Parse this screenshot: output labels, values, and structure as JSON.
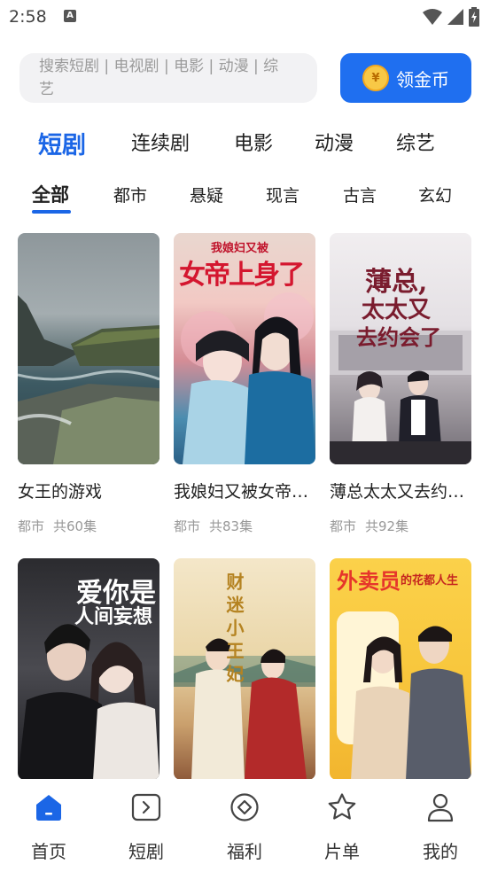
{
  "status": {
    "time": "2:58",
    "notification": "A"
  },
  "search": {
    "placeholder_line1": "搜索短剧 | 电视剧 | 电影 | 动漫 | 综",
    "placeholder_line2": "艺"
  },
  "coin_button": {
    "icon": "¥",
    "label": "领金币"
  },
  "category_tabs": [
    {
      "label": "短剧",
      "active": true
    },
    {
      "label": "连续剧"
    },
    {
      "label": "电影"
    },
    {
      "label": "动漫"
    },
    {
      "label": "综艺"
    }
  ],
  "genre_tabs": [
    {
      "label": "全部",
      "active": true
    },
    {
      "label": "都市"
    },
    {
      "label": "悬疑"
    },
    {
      "label": "现言"
    },
    {
      "label": "古言"
    },
    {
      "label": "玄幻"
    }
  ],
  "dramas": [
    {
      "title": "女王的游戏",
      "genre": "都市",
      "episodes": "共60集"
    },
    {
      "title": "我娘妇又被女帝…",
      "genre": "都市",
      "episodes": "共83集",
      "poster_top": "我娘妇又被",
      "poster_main": "女帝上身了"
    },
    {
      "title": "薄总太太又去约…",
      "genre": "都市",
      "episodes": "共92集",
      "poster_main_1": "薄总,",
      "poster_main_2": "太太又",
      "poster_main_3": "去约会了"
    },
    {
      "title": "",
      "genre": "",
      "episodes": "",
      "poster_main_1": "爱你是",
      "poster_main_2": "人间妄想"
    },
    {
      "title": "",
      "genre": "",
      "episodes": "",
      "poster_main": "财迷小王妃"
    },
    {
      "title": "",
      "genre": "",
      "episodes": "",
      "poster_main": "外卖员",
      "poster_sub": "的花都人生"
    }
  ],
  "bottom_nav": [
    {
      "label": "首页",
      "icon": "home-icon",
      "active": true
    },
    {
      "label": "短剧",
      "icon": "play-icon"
    },
    {
      "label": "福利",
      "icon": "gift-icon"
    },
    {
      "label": "片单",
      "icon": "star-icon"
    },
    {
      "label": "我的",
      "icon": "user-icon"
    }
  ],
  "colors": {
    "accent": "#1b66e6",
    "coin_button": "#1f6ff0",
    "coin": "#f8c846"
  }
}
